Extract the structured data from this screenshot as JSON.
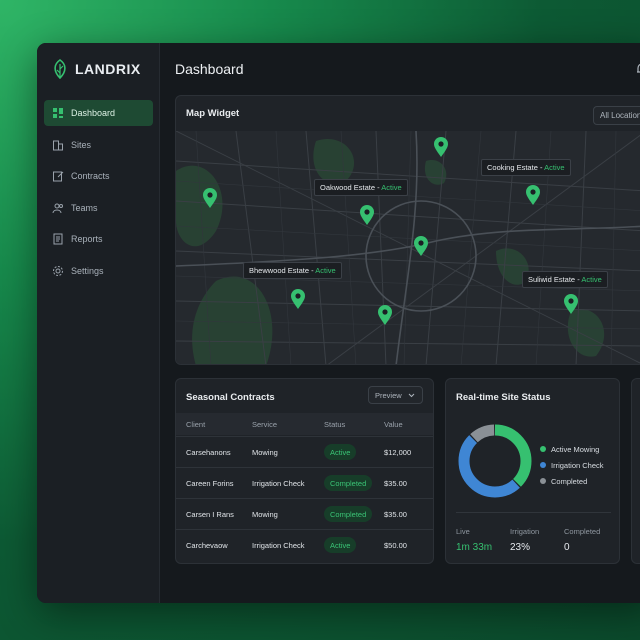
{
  "brand": {
    "name": "LANDRIX",
    "accent": "#36c070"
  },
  "sidebar": {
    "items": [
      {
        "label": "Dashboard",
        "icon": "grid-icon",
        "active": true
      },
      {
        "label": "Sites",
        "icon": "building-icon"
      },
      {
        "label": "Contracts",
        "icon": "edit-icon"
      },
      {
        "label": "Teams",
        "icon": "users-icon"
      },
      {
        "label": "Reports",
        "icon": "document-icon"
      },
      {
        "label": "Settings",
        "icon": "gear-icon"
      }
    ]
  },
  "header": {
    "title": "Dashboard"
  },
  "map": {
    "title": "Map Widget",
    "filter_label": "All Locations",
    "labels": [
      {
        "name": "Oakwood Estate - ",
        "status": "Active"
      },
      {
        "name": "Cooking Estate - ",
        "status": "Active"
      },
      {
        "name": "Bhewwood Estate - ",
        "status": "Active"
      },
      {
        "name": "Suliwid Estate - ",
        "status": "Active"
      }
    ]
  },
  "contracts": {
    "title": "Seasonal Contracts",
    "preview_label": "Preview",
    "columns": [
      "Client",
      "Service",
      "Status",
      "Value"
    ],
    "rows": [
      {
        "client": "Carsehanons",
        "service": "Mowing",
        "status": "Active",
        "value": "$12,000"
      },
      {
        "client": "Careen Forins",
        "service": "Irrigation Check",
        "status": "Completed",
        "value": "$35.00"
      },
      {
        "client": "Carsen I Rans",
        "service": "Mowing",
        "status": "Completed",
        "value": "$35.00"
      },
      {
        "client": "Carchevaow",
        "service": "Irrigation Check",
        "status": "Active",
        "value": "$50.00"
      }
    ]
  },
  "site_status": {
    "title": "Real-time Site Status",
    "legend": [
      {
        "label": "Active Mowing",
        "color": "#36c070"
      },
      {
        "label": "Irrigation Check",
        "color": "#3f86d4"
      },
      {
        "label": "Completed",
        "color": "#8a9096"
      }
    ],
    "stats": [
      {
        "label": "Live",
        "value": "1m 33m"
      },
      {
        "label": "Irrigation",
        "value": "23%"
      },
      {
        "label": "Completed",
        "value": "0"
      }
    ]
  },
  "chart_data": {
    "type": "pie",
    "categories": [
      "Active Mowing",
      "Irrigation Check",
      "Completed"
    ],
    "values": [
      38,
      50,
      12
    ]
  }
}
